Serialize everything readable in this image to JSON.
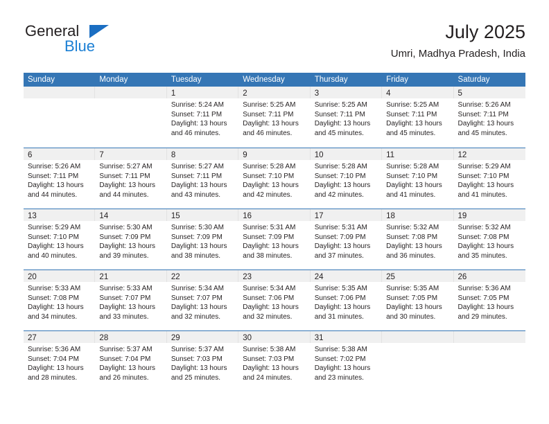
{
  "logo": {
    "word_one": "General",
    "word_two": "Blue",
    "triangle_color": "#1b6ec2",
    "blue_color": "#1b7fd4"
  },
  "header": {
    "title": "July 2025",
    "subtitle": "Umri, Madhya Pradesh, India"
  },
  "theme": {
    "header_band": "#3576b5",
    "day_band": "#f0f0f0",
    "text": "#231f20"
  },
  "weekdays": [
    "Sunday",
    "Monday",
    "Tuesday",
    "Wednesday",
    "Thursday",
    "Friday",
    "Saturday"
  ],
  "weeks": [
    [
      {
        "day": "",
        "sunrise": "",
        "sunset": "",
        "daylight_1": "",
        "daylight_2": ""
      },
      {
        "day": "",
        "sunrise": "",
        "sunset": "",
        "daylight_1": "",
        "daylight_2": ""
      },
      {
        "day": "1",
        "sunrise": "Sunrise: 5:24 AM",
        "sunset": "Sunset: 7:11 PM",
        "daylight_1": "Daylight: 13 hours",
        "daylight_2": "and 46 minutes."
      },
      {
        "day": "2",
        "sunrise": "Sunrise: 5:25 AM",
        "sunset": "Sunset: 7:11 PM",
        "daylight_1": "Daylight: 13 hours",
        "daylight_2": "and 46 minutes."
      },
      {
        "day": "3",
        "sunrise": "Sunrise: 5:25 AM",
        "sunset": "Sunset: 7:11 PM",
        "daylight_1": "Daylight: 13 hours",
        "daylight_2": "and 45 minutes."
      },
      {
        "day": "4",
        "sunrise": "Sunrise: 5:25 AM",
        "sunset": "Sunset: 7:11 PM",
        "daylight_1": "Daylight: 13 hours",
        "daylight_2": "and 45 minutes."
      },
      {
        "day": "5",
        "sunrise": "Sunrise: 5:26 AM",
        "sunset": "Sunset: 7:11 PM",
        "daylight_1": "Daylight: 13 hours",
        "daylight_2": "and 45 minutes."
      }
    ],
    [
      {
        "day": "6",
        "sunrise": "Sunrise: 5:26 AM",
        "sunset": "Sunset: 7:11 PM",
        "daylight_1": "Daylight: 13 hours",
        "daylight_2": "and 44 minutes."
      },
      {
        "day": "7",
        "sunrise": "Sunrise: 5:27 AM",
        "sunset": "Sunset: 7:11 PM",
        "daylight_1": "Daylight: 13 hours",
        "daylight_2": "and 44 minutes."
      },
      {
        "day": "8",
        "sunrise": "Sunrise: 5:27 AM",
        "sunset": "Sunset: 7:11 PM",
        "daylight_1": "Daylight: 13 hours",
        "daylight_2": "and 43 minutes."
      },
      {
        "day": "9",
        "sunrise": "Sunrise: 5:28 AM",
        "sunset": "Sunset: 7:10 PM",
        "daylight_1": "Daylight: 13 hours",
        "daylight_2": "and 42 minutes."
      },
      {
        "day": "10",
        "sunrise": "Sunrise: 5:28 AM",
        "sunset": "Sunset: 7:10 PM",
        "daylight_1": "Daylight: 13 hours",
        "daylight_2": "and 42 minutes."
      },
      {
        "day": "11",
        "sunrise": "Sunrise: 5:28 AM",
        "sunset": "Sunset: 7:10 PM",
        "daylight_1": "Daylight: 13 hours",
        "daylight_2": "and 41 minutes."
      },
      {
        "day": "12",
        "sunrise": "Sunrise: 5:29 AM",
        "sunset": "Sunset: 7:10 PM",
        "daylight_1": "Daylight: 13 hours",
        "daylight_2": "and 41 minutes."
      }
    ],
    [
      {
        "day": "13",
        "sunrise": "Sunrise: 5:29 AM",
        "sunset": "Sunset: 7:10 PM",
        "daylight_1": "Daylight: 13 hours",
        "daylight_2": "and 40 minutes."
      },
      {
        "day": "14",
        "sunrise": "Sunrise: 5:30 AM",
        "sunset": "Sunset: 7:09 PM",
        "daylight_1": "Daylight: 13 hours",
        "daylight_2": "and 39 minutes."
      },
      {
        "day": "15",
        "sunrise": "Sunrise: 5:30 AM",
        "sunset": "Sunset: 7:09 PM",
        "daylight_1": "Daylight: 13 hours",
        "daylight_2": "and 38 minutes."
      },
      {
        "day": "16",
        "sunrise": "Sunrise: 5:31 AM",
        "sunset": "Sunset: 7:09 PM",
        "daylight_1": "Daylight: 13 hours",
        "daylight_2": "and 38 minutes."
      },
      {
        "day": "17",
        "sunrise": "Sunrise: 5:31 AM",
        "sunset": "Sunset: 7:09 PM",
        "daylight_1": "Daylight: 13 hours",
        "daylight_2": "and 37 minutes."
      },
      {
        "day": "18",
        "sunrise": "Sunrise: 5:32 AM",
        "sunset": "Sunset: 7:08 PM",
        "daylight_1": "Daylight: 13 hours",
        "daylight_2": "and 36 minutes."
      },
      {
        "day": "19",
        "sunrise": "Sunrise: 5:32 AM",
        "sunset": "Sunset: 7:08 PM",
        "daylight_1": "Daylight: 13 hours",
        "daylight_2": "and 35 minutes."
      }
    ],
    [
      {
        "day": "20",
        "sunrise": "Sunrise: 5:33 AM",
        "sunset": "Sunset: 7:08 PM",
        "daylight_1": "Daylight: 13 hours",
        "daylight_2": "and 34 minutes."
      },
      {
        "day": "21",
        "sunrise": "Sunrise: 5:33 AM",
        "sunset": "Sunset: 7:07 PM",
        "daylight_1": "Daylight: 13 hours",
        "daylight_2": "and 33 minutes."
      },
      {
        "day": "22",
        "sunrise": "Sunrise: 5:34 AM",
        "sunset": "Sunset: 7:07 PM",
        "daylight_1": "Daylight: 13 hours",
        "daylight_2": "and 32 minutes."
      },
      {
        "day": "23",
        "sunrise": "Sunrise: 5:34 AM",
        "sunset": "Sunset: 7:06 PM",
        "daylight_1": "Daylight: 13 hours",
        "daylight_2": "and 32 minutes."
      },
      {
        "day": "24",
        "sunrise": "Sunrise: 5:35 AM",
        "sunset": "Sunset: 7:06 PM",
        "daylight_1": "Daylight: 13 hours",
        "daylight_2": "and 31 minutes."
      },
      {
        "day": "25",
        "sunrise": "Sunrise: 5:35 AM",
        "sunset": "Sunset: 7:05 PM",
        "daylight_1": "Daylight: 13 hours",
        "daylight_2": "and 30 minutes."
      },
      {
        "day": "26",
        "sunrise": "Sunrise: 5:36 AM",
        "sunset": "Sunset: 7:05 PM",
        "daylight_1": "Daylight: 13 hours",
        "daylight_2": "and 29 minutes."
      }
    ],
    [
      {
        "day": "27",
        "sunrise": "Sunrise: 5:36 AM",
        "sunset": "Sunset: 7:04 PM",
        "daylight_1": "Daylight: 13 hours",
        "daylight_2": "and 28 minutes."
      },
      {
        "day": "28",
        "sunrise": "Sunrise: 5:37 AM",
        "sunset": "Sunset: 7:04 PM",
        "daylight_1": "Daylight: 13 hours",
        "daylight_2": "and 26 minutes."
      },
      {
        "day": "29",
        "sunrise": "Sunrise: 5:37 AM",
        "sunset": "Sunset: 7:03 PM",
        "daylight_1": "Daylight: 13 hours",
        "daylight_2": "and 25 minutes."
      },
      {
        "day": "30",
        "sunrise": "Sunrise: 5:38 AM",
        "sunset": "Sunset: 7:03 PM",
        "daylight_1": "Daylight: 13 hours",
        "daylight_2": "and 24 minutes."
      },
      {
        "day": "31",
        "sunrise": "Sunrise: 5:38 AM",
        "sunset": "Sunset: 7:02 PM",
        "daylight_1": "Daylight: 13 hours",
        "daylight_2": "and 23 minutes."
      },
      {
        "day": "",
        "sunrise": "",
        "sunset": "",
        "daylight_1": "",
        "daylight_2": ""
      },
      {
        "day": "",
        "sunrise": "",
        "sunset": "",
        "daylight_1": "",
        "daylight_2": ""
      }
    ]
  ]
}
